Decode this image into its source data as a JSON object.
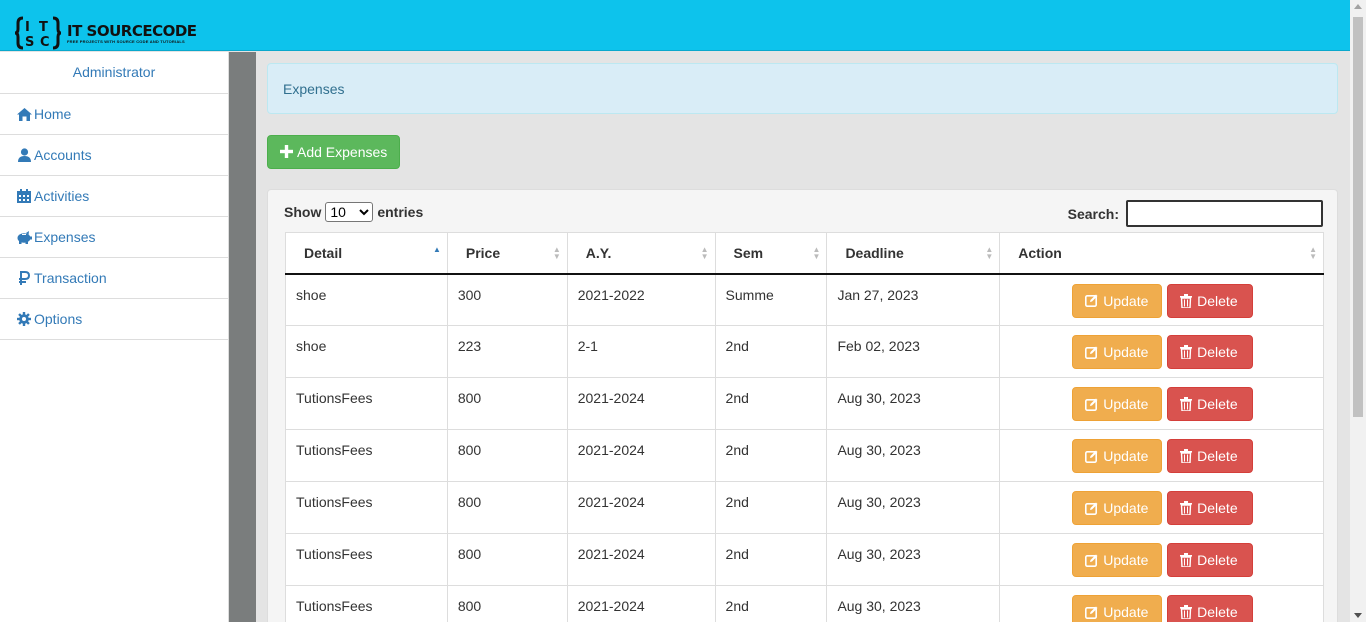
{
  "brand": {
    "logo_text": "IT SOURCECODE",
    "logo_tagline": "FREE PROJECTS WITH SOURCE CODE AND TUTORIALS",
    "logo_mark_letters": "ITSC",
    "color": "#0dc3ec"
  },
  "sidebar": {
    "header": "Administrator",
    "items": [
      {
        "label": "Home",
        "icon": "home-icon"
      },
      {
        "label": "Accounts",
        "icon": "user-icon"
      },
      {
        "label": "Activities",
        "icon": "calendar-icon"
      },
      {
        "label": "Expenses",
        "icon": "piggy-bank-icon"
      },
      {
        "label": "Transaction",
        "icon": "ruble-icon"
      },
      {
        "label": "Options",
        "icon": "gear-icon"
      }
    ]
  },
  "main": {
    "breadcrumb": "Expenses",
    "add_button": "Add Expenses",
    "show_label": "Show",
    "entries_label": "entries",
    "entries_value": "10",
    "search_label": "Search:",
    "search_value": ""
  },
  "table": {
    "columns": [
      "Detail",
      "Price",
      "A.Y.",
      "Sem",
      "Deadline",
      "Action"
    ],
    "update_label": "Update",
    "delete_label": "Delete",
    "rows": [
      {
        "detail": "shoe",
        "price": "300",
        "ay": "2021-2022",
        "sem": "Summe",
        "deadline": "Jan 27, 2023"
      },
      {
        "detail": "shoe",
        "price": "223",
        "ay": "2-1",
        "sem": "2nd",
        "deadline": "Feb 02, 2023"
      },
      {
        "detail": "TutionsFees",
        "price": "800",
        "ay": "2021-2024",
        "sem": "2nd",
        "deadline": "Aug 30, 2023"
      },
      {
        "detail": "TutionsFees",
        "price": "800",
        "ay": "2021-2024",
        "sem": "2nd",
        "deadline": "Aug 30, 2023"
      },
      {
        "detail": "TutionsFees",
        "price": "800",
        "ay": "2021-2024",
        "sem": "2nd",
        "deadline": "Aug 30, 2023"
      },
      {
        "detail": "TutionsFees",
        "price": "800",
        "ay": "2021-2024",
        "sem": "2nd",
        "deadline": "Aug 30, 2023"
      },
      {
        "detail": "TutionsFees",
        "price": "800",
        "ay": "2021-2024",
        "sem": "2nd",
        "deadline": "Aug 30, 2023"
      }
    ]
  },
  "colors": {
    "accent_link": "#337ab7",
    "success": "#5cb85c",
    "warning": "#f0ad4e",
    "danger": "#d9534f",
    "info_bg": "#d9edf7"
  }
}
